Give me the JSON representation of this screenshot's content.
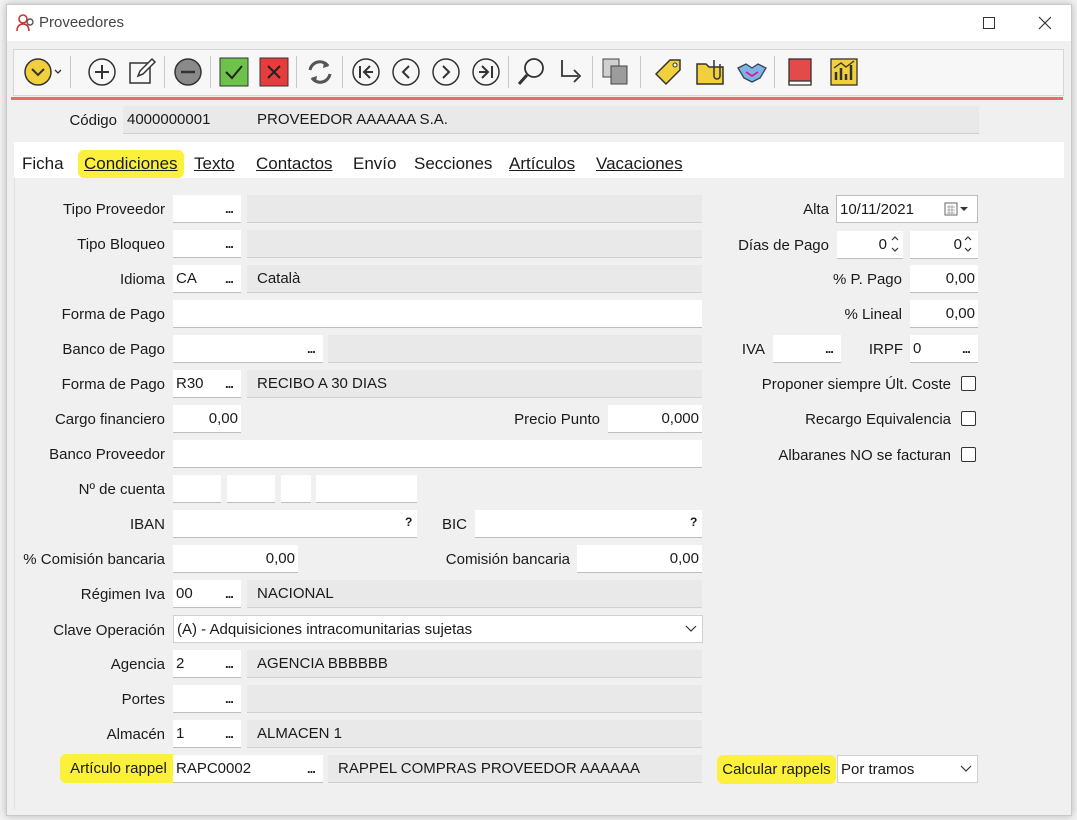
{
  "window": {
    "title": "Proveedores"
  },
  "header": {
    "codigo_label": "Código",
    "codigo_value": "4000000001",
    "name_value": "PROVEEDOR AAAAAA S.A."
  },
  "tabs": [
    {
      "label": "Ficha"
    },
    {
      "label": "Condiciones"
    },
    {
      "label": "Texto"
    },
    {
      "label": "Contactos"
    },
    {
      "label": "Envío"
    },
    {
      "label": "Secciones"
    },
    {
      "label": "Artículos"
    },
    {
      "label": "Vacaciones"
    }
  ],
  "left": {
    "tipo_proveedor": {
      "label": "Tipo Proveedor",
      "code": "",
      "desc": ""
    },
    "tipo_bloqueo": {
      "label": "Tipo Bloqueo",
      "code": "",
      "desc": ""
    },
    "idioma": {
      "label": "Idioma",
      "code": "CA",
      "desc": "Català"
    },
    "forma_pago_text": {
      "label": "Forma de Pago",
      "value": ""
    },
    "banco_pago": {
      "label": "Banco de Pago",
      "code": "",
      "desc": ""
    },
    "forma_pago": {
      "label": "Forma de Pago",
      "code": "R30",
      "desc": "RECIBO A 30 DIAS"
    },
    "cargo_financiero": {
      "label": "Cargo financiero",
      "value": "0,00"
    },
    "precio_punto": {
      "label": "Precio Punto",
      "value": "0,000"
    },
    "banco_proveedor": {
      "label": "Banco Proveedor",
      "value": ""
    },
    "num_cuenta": {
      "label": "Nº de cuenta"
    },
    "iban": {
      "label": "IBAN",
      "value": "",
      "help": "?"
    },
    "bic": {
      "label": "BIC",
      "value": "",
      "help": "?"
    },
    "comision_pct": {
      "label": "% Comisión bancaria",
      "value": "0,00"
    },
    "comision": {
      "label": "Comisión bancaria",
      "value": "0,00"
    },
    "regimen_iva": {
      "label": "Régimen Iva",
      "code": "00",
      "desc": "NACIONAL"
    },
    "clave_operacion": {
      "label": "Clave Operación",
      "value": "(A) - Adquisiciones intracomunitarias sujetas"
    },
    "agencia": {
      "label": "Agencia",
      "code": "2",
      "desc": "AGENCIA BBBBBB"
    },
    "portes": {
      "label": "Portes",
      "code": "",
      "desc": ""
    },
    "almacen": {
      "label": "Almacén",
      "code": "1",
      "desc": "ALMACEN 1"
    },
    "articulo_rappel": {
      "label": "Artículo rappel",
      "code": "RAPC0002",
      "desc": "RAPPEL COMPRAS PROVEEDOR AAAAAA"
    }
  },
  "right": {
    "alta": {
      "label": "Alta",
      "value": "10/11/2021"
    },
    "dias_pago": {
      "label": "Días de Pago",
      "value1": "0",
      "value2": "0"
    },
    "p_pago": {
      "label": "% P. Pago",
      "value": "0,00"
    },
    "lineal": {
      "label": "% Lineal",
      "value": "0,00"
    },
    "iva": {
      "label": "IVA",
      "value": ""
    },
    "irpf": {
      "label": "IRPF",
      "value": "0"
    },
    "proponer": {
      "label": "Proponer siempre Últ. Coste"
    },
    "recargo": {
      "label": "Recargo Equivalencia"
    },
    "albaranes": {
      "label": "Albaranes NO se facturan"
    },
    "calcular_rappels": {
      "label": "Calcular rappels",
      "value": "Por tramos"
    }
  },
  "colors": {
    "highlight": "#fbf13d",
    "accent_line": "#e86a6a",
    "readonly": "#e9e9e9"
  }
}
